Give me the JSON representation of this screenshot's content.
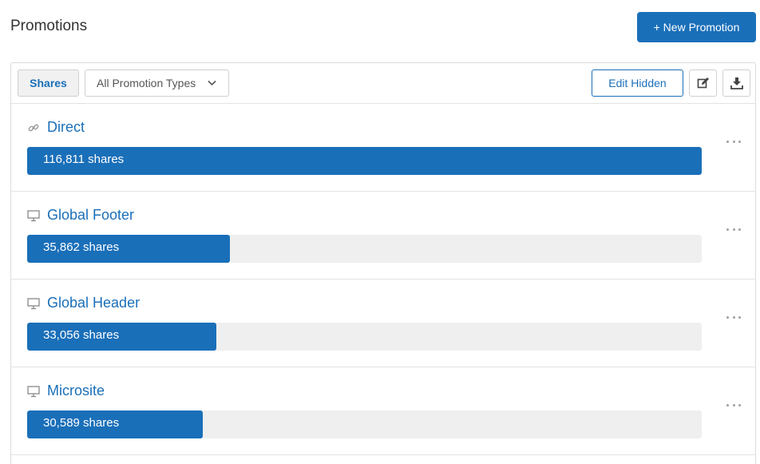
{
  "header": {
    "title": "Promotions",
    "new_button_label": "+ New Promotion"
  },
  "toolbar": {
    "shares_tab_label": "Shares",
    "type_filter_value": "All Promotion Types",
    "edit_hidden_label": "Edit Hidden",
    "edit_icon": "edit-icon",
    "download_icon": "download-icon"
  },
  "colors": {
    "accent": "#1a6fb9",
    "bar_track": "#efefef"
  },
  "promotions": [
    {
      "name": "Direct",
      "icon": "link-icon",
      "shares_label": "116,811 shares",
      "shares": 116811,
      "bar_fraction": 1.0
    },
    {
      "name": "Global Footer",
      "icon": "monitor-icon",
      "shares_label": "35,862 shares",
      "shares": 35862,
      "bar_fraction": 0.3
    },
    {
      "name": "Global Header",
      "icon": "monitor-icon",
      "shares_label": "33,056 shares",
      "shares": 33056,
      "bar_fraction": 0.28
    },
    {
      "name": "Microsite",
      "icon": "monitor-icon",
      "shares_label": "30,589 shares",
      "shares": 30589,
      "bar_fraction": 0.26
    }
  ]
}
